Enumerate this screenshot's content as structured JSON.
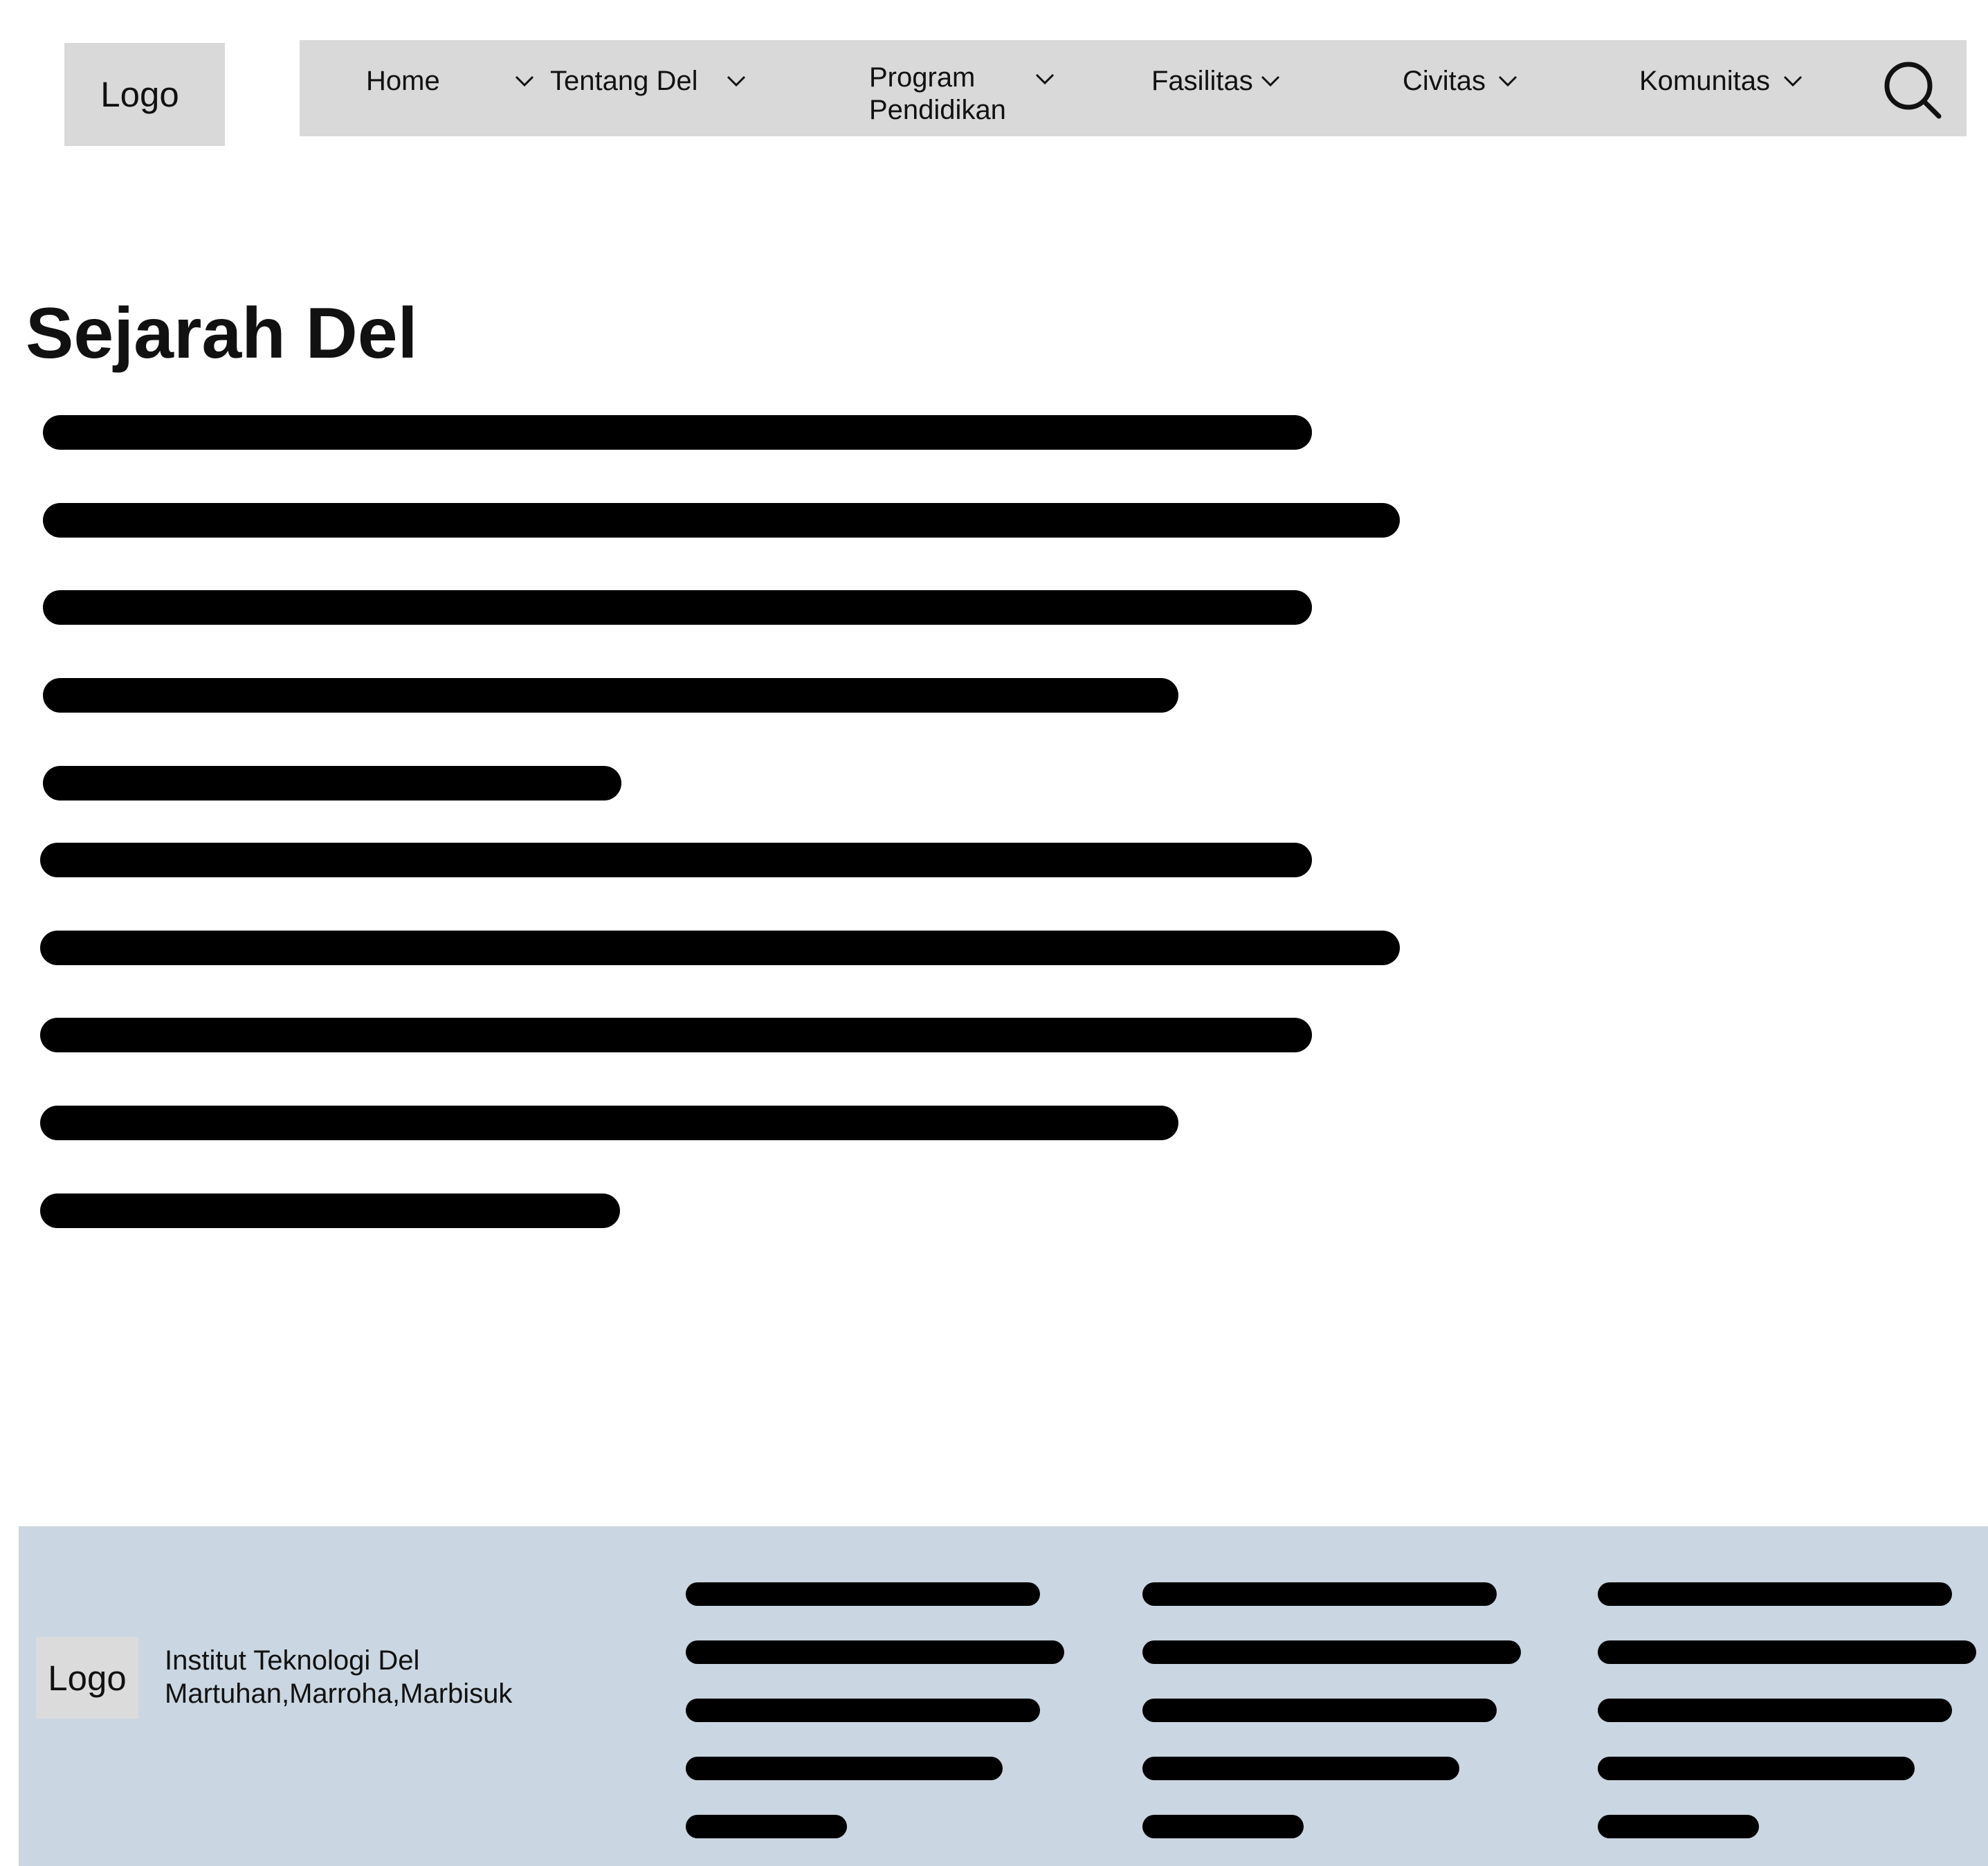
{
  "header": {
    "logo_label": "Logo",
    "nav": [
      {
        "label": "Home"
      },
      {
        "label": "Tentang Del"
      },
      {
        "label": "Program Pendidikan"
      },
      {
        "label": "Fasilitas"
      },
      {
        "label": "Civitas"
      },
      {
        "label": "Komunitas"
      }
    ],
    "search_icon": "search-icon",
    "chevron_icon": "chevron-down-icon"
  },
  "main": {
    "title": "Sejarah Del",
    "placeholder_line_count": 10
  },
  "footer": {
    "logo_label": "Logo",
    "institution_name": "Institut Teknologi Del",
    "motto": "Martuhan,Marroha,Marbisuk",
    "link_columns": 3,
    "links_per_column": 5
  },
  "colors": {
    "nav_background": "#d9d9d9",
    "logo_background": "#d9d9d9",
    "footer_background": "#cad6e1",
    "placeholder_bar": "#000000",
    "text": "#111111"
  }
}
